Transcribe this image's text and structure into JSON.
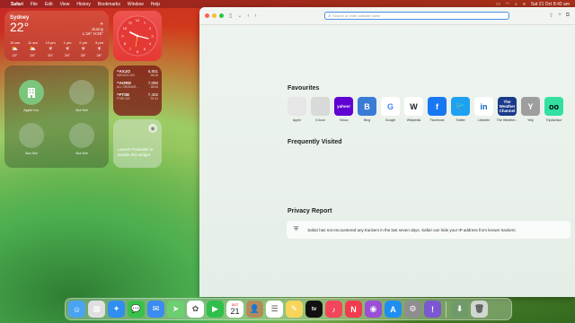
{
  "menubar": {
    "app": "Safari",
    "items": [
      "File",
      "Edit",
      "View",
      "History",
      "Bookmarks",
      "Window",
      "Help"
    ],
    "datetime": "Sat 21 Oct 8:42 am"
  },
  "weather": {
    "city": "Sydney",
    "temp": "22°",
    "condition": "Sunny",
    "range": "L:16° H:26°",
    "hours": [
      {
        "time": "10 am",
        "temp": "22°"
      },
      {
        "time": "11 am",
        "temp": "24°"
      },
      {
        "time": "12 pm",
        "temp": "25°"
      },
      {
        "time": "1 pm",
        "temp": "25°"
      },
      {
        "time": "2 pm",
        "temp": "25°"
      },
      {
        "time": "3 pm",
        "temp": "26°"
      }
    ]
  },
  "contacts": {
    "items": [
      {
        "label": "Apple Inc."
      },
      {
        "label": "Not Set"
      },
      {
        "label": "Not Set"
      },
      {
        "label": "Not Set"
      }
    ]
  },
  "stocks": {
    "items": [
      {
        "symbol": "^AXJO",
        "sub": "S&P/ASX 200",
        "value": "6,901",
        "change": "-55.20"
      },
      {
        "symbol": "^AORD",
        "sub": "ALL ORDINAR...",
        "value": "7,090",
        "change": "-55.00"
      },
      {
        "symbol": "^FTSE",
        "sub": "FTSE 100",
        "value": "7,402",
        "change": "-97.41"
      }
    ]
  },
  "podcasts": {
    "text": "Launch Podcasts to enable this widget"
  },
  "safari": {
    "address_placeholder": "Search or enter website name",
    "favourites_title": "Favourites",
    "frequently_title": "Frequently Visited",
    "privacy_title": "Privacy Report",
    "privacy_text": "Safari has not encountered any trackers in the last seven days. Safari can hide your IP address from known trackers.",
    "favourites": [
      {
        "label": "Apple",
        "glyph": "",
        "bg": "#e6e6e6",
        "fg": "#333"
      },
      {
        "label": "iCloud",
        "glyph": "",
        "bg": "#d9d9d9",
        "fg": "#555"
      },
      {
        "label": "Yahoo",
        "glyph": "yahoo!",
        "bg": "#5f01d1",
        "fg": "#fff"
      },
      {
        "label": "Bing",
        "glyph": "B",
        "bg": "#3a7bd5",
        "fg": "#fff"
      },
      {
        "label": "Google",
        "glyph": "G",
        "bg": "#ffffff",
        "fg": "#4285f4"
      },
      {
        "label": "Wikipedia",
        "glyph": "W",
        "bg": "#ffffff",
        "fg": "#222"
      },
      {
        "label": "Facebook",
        "glyph": "f",
        "bg": "#1877f2",
        "fg": "#fff"
      },
      {
        "label": "Twitter",
        "glyph": "🐦",
        "bg": "#1da1f2",
        "fg": "#fff"
      },
      {
        "label": "LinkedIn",
        "glyph": "in",
        "bg": "#ffffff",
        "fg": "#0a66c2"
      },
      {
        "label": "The Weather...",
        "glyph": "The Weather Channel",
        "bg": "#1a3a8a",
        "fg": "#fff"
      },
      {
        "label": "Yelp",
        "glyph": "Y",
        "bg": "#9e9e9e",
        "fg": "#fff"
      },
      {
        "label": "TripAdvisor",
        "glyph": "oo",
        "bg": "#34e0a1",
        "fg": "#000"
      }
    ]
  },
  "dock": {
    "calendar_month": "OCT",
    "calendar_day": "21",
    "apps": [
      {
        "name": "finder-icon",
        "bg": "#4aa3f0",
        "glyph": "☺"
      },
      {
        "name": "launchpad-icon",
        "bg": "#e0e0e0",
        "glyph": "▦"
      },
      {
        "name": "safari-icon",
        "bg": "#2f8ef0",
        "glyph": "✦"
      },
      {
        "name": "messages-icon",
        "bg": "#39c24b",
        "glyph": "💬"
      },
      {
        "name": "mail-icon",
        "bg": "#3b8bf0",
        "glyph": "✉"
      },
      {
        "name": "maps-icon",
        "bg": "#6ccf70",
        "glyph": "➤"
      },
      {
        "name": "photos-icon",
        "bg": "#ffffff",
        "glyph": "✿"
      },
      {
        "name": "facetime-icon",
        "bg": "#2fbf4a",
        "glyph": "▶"
      },
      {
        "name": "calendar-icon",
        "bg": "#ffffff",
        "glyph": ""
      },
      {
        "name": "contacts-icon",
        "bg": "#b58a5a",
        "glyph": "👤"
      },
      {
        "name": "reminders-icon",
        "bg": "#ffffff",
        "glyph": "☰"
      },
      {
        "name": "notes-icon",
        "bg": "#f7d55a",
        "glyph": "✎"
      },
      {
        "name": "tv-icon",
        "bg": "#111111",
        "glyph": "tv"
      },
      {
        "name": "music-icon",
        "bg": "#f3465b",
        "glyph": "♪"
      },
      {
        "name": "news-icon",
        "bg": "#f23b4d",
        "glyph": "N"
      },
      {
        "name": "podcasts-icon",
        "bg": "#9a4fd6",
        "glyph": "◉"
      },
      {
        "name": "app-store-icon",
        "bg": "#1f8ef1",
        "glyph": "A"
      },
      {
        "name": "system-settings-icon",
        "bg": "#8e8e8e",
        "glyph": "⚙"
      },
      {
        "name": "feedback-icon",
        "bg": "#7b57d1",
        "glyph": "!"
      },
      {
        "name": "downloads-icon",
        "bg": "#6f9b6a",
        "glyph": "⬇"
      },
      {
        "name": "trash-icon",
        "bg": "#d0d6d0",
        "glyph": "🗑"
      }
    ]
  }
}
